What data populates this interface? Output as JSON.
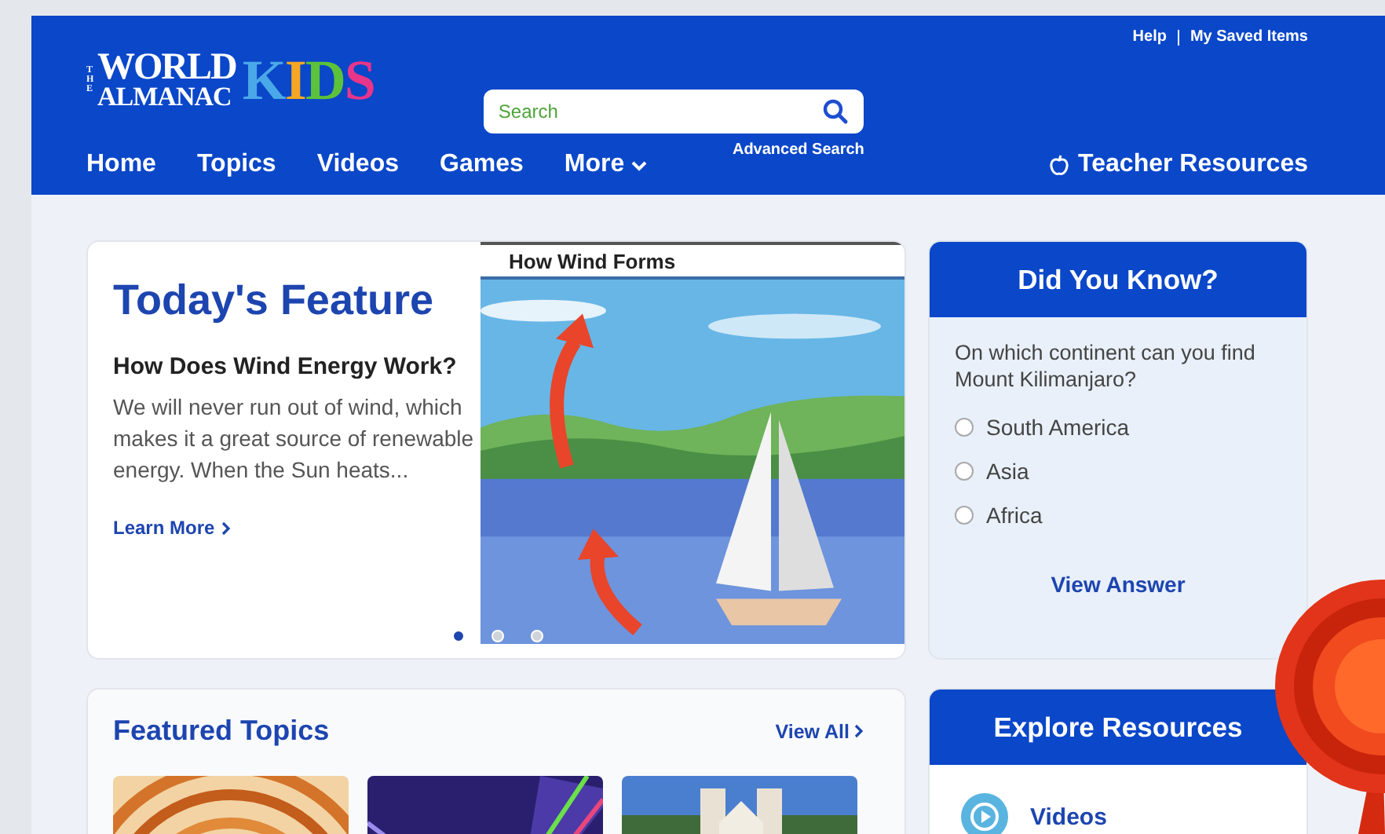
{
  "header": {
    "logo": {
      "the": "THE",
      "line1": "WORLD",
      "line2": "ALMANAC",
      "kids": [
        {
          "letter": "K",
          "color": "#4aa8e8"
        },
        {
          "letter": "I",
          "color": "#f5a623"
        },
        {
          "letter": "D",
          "color": "#5cc23a"
        },
        {
          "letter": "S",
          "color": "#e8358a"
        }
      ]
    },
    "search": {
      "placeholder": "Search"
    },
    "advanced_search": "Advanced Search",
    "utility_links": [
      "Help",
      "My Saved Items"
    ],
    "nav": [
      {
        "label": "Home",
        "dropdown": false
      },
      {
        "label": "Topics",
        "dropdown": false
      },
      {
        "label": "Videos",
        "dropdown": false
      },
      {
        "label": "Games",
        "dropdown": false
      },
      {
        "label": "More",
        "dropdown": true
      }
    ],
    "teacher_resources": "Teacher Resources"
  },
  "feature": {
    "heading": "Today's Feature",
    "title": "How Does Wind Energy Work?",
    "summary": "We will never run out of wind, which makes it a great source of renewable energy. When the Sun heats...",
    "link": "Learn More",
    "image_title": "How Wind Forms",
    "slides": [
      {
        "selected": true
      },
      {
        "selected": false
      },
      {
        "selected": false
      }
    ]
  },
  "did_you_know": {
    "heading": "Did You Know?",
    "question": "On which continent can you find Mount Kilimanjaro?",
    "options": [
      {
        "label": "South America",
        "selected": false
      },
      {
        "label": "Asia",
        "selected": false
      },
      {
        "label": "Africa",
        "selected": false
      }
    ],
    "action": "View Answer"
  },
  "featured_topics": {
    "heading": "Featured Topics",
    "link": "View All",
    "topics": [
      {
        "kind": "basket"
      },
      {
        "kind": "lights"
      },
      {
        "kind": "mission"
      }
    ]
  },
  "explore_resources": {
    "heading": "Explore Resources",
    "items": [
      {
        "label": "Videos",
        "kind": "video"
      }
    ]
  }
}
